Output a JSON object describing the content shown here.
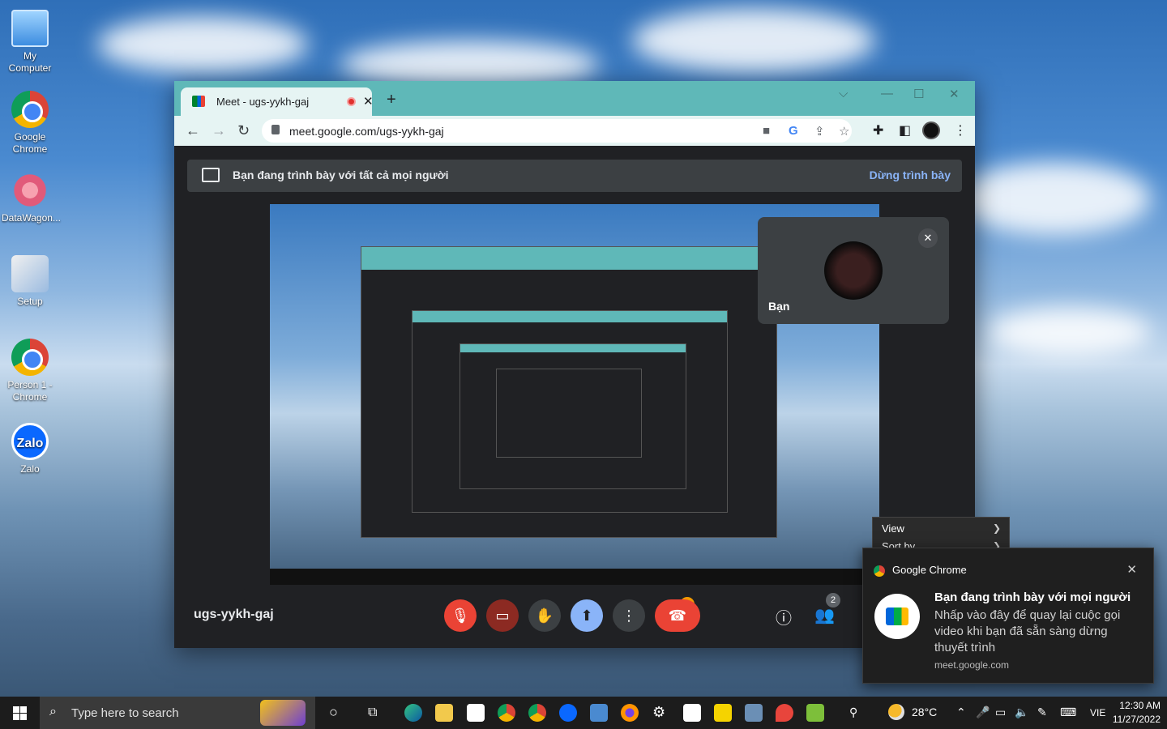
{
  "desktop": {
    "icons": [
      {
        "label": "My Computer",
        "icon": "my-computer-icon"
      },
      {
        "label": "Google Chrome",
        "icon": "chrome-icon"
      },
      {
        "label": "DataWagon...",
        "icon": "datawagon-icon"
      },
      {
        "label": "Setup",
        "icon": "setup-icon"
      },
      {
        "label": "Person 1 - Chrome",
        "icon": "chrome-profile-icon"
      },
      {
        "label": "Zalo",
        "icon": "zalo-icon"
      }
    ]
  },
  "browser": {
    "tab_title": "Meet - ugs-yykh-gaj",
    "tab_close": "✕",
    "new_tab": "+",
    "url": "meet.google.com/ugs-yykh-gaj",
    "colors": {
      "tabstrip": "#5fb8b8",
      "toolbar": "#e6f4f3"
    }
  },
  "meet": {
    "presenting_banner": "Bạn đang trình bày với tất cả mọi người",
    "stop_presenting": "Dừng trình bày",
    "self_tile_name": "Bạn",
    "meeting_code": "ugs-yykh-gaj",
    "participants_count": "2",
    "camera_warning": "!",
    "colors": {
      "end_call": "#ea4335",
      "present": "#8ab4f8",
      "link": "#8ab4f8"
    }
  },
  "context_menu": {
    "items": [
      {
        "label": "View"
      },
      {
        "label": "Sort by"
      }
    ]
  },
  "notification": {
    "app": "Google Chrome",
    "title": "Bạn đang trình bày với mọi người",
    "body": "Nhấp vào đây để quay lại cuộc gọi video khi bạn đã sẵn sàng dừng thuyết trình",
    "source": "meet.google.com",
    "close": "✕"
  },
  "taskbar": {
    "search_placeholder": "Type here to search",
    "weather": "28°C",
    "language": "VIE",
    "time": "12:30 AM",
    "date": "11/27/2022"
  }
}
